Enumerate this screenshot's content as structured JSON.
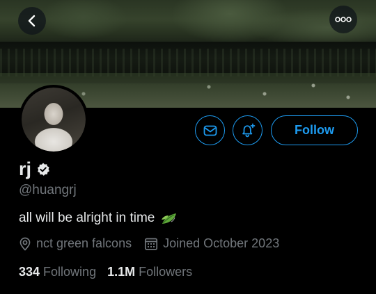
{
  "profile": {
    "name": "rj",
    "handle": "@huangrj",
    "bio": "all will be alright in time",
    "location": "nct green falcons",
    "joined": "Joined October 2023",
    "verified": true
  },
  "actions": {
    "follow_label": "Follow"
  },
  "stats": {
    "following_count": "334",
    "following_label": "Following",
    "followers_count": "1.1M",
    "followers_label": "Followers"
  },
  "icons": [
    "back-arrow-icon",
    "more-icon",
    "mail-icon",
    "bell-plus-icon",
    "verified-badge-icon",
    "leaf-emoji-icon",
    "location-pin-icon",
    "calendar-icon"
  ],
  "colors": {
    "accent": "#1d9bf0",
    "background": "#000000",
    "text_primary": "#e7e9ea",
    "text_secondary": "#71767b"
  }
}
